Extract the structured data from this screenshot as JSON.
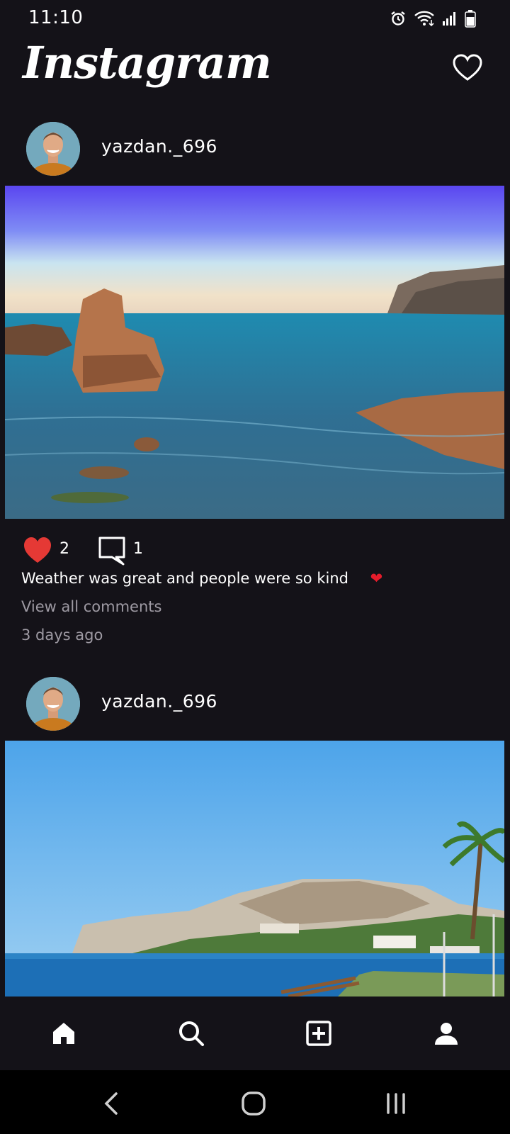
{
  "status_bar": {
    "time": "11:10",
    "icons": [
      "alarm-icon",
      "wifi-icon",
      "signal-icon",
      "battery-icon"
    ]
  },
  "header": {
    "logo": "Instagram",
    "activity_icon": "heart-outline-icon"
  },
  "posts": [
    {
      "username": "yazdan._696",
      "likes": "2",
      "comments": "1",
      "caption": "Weather was great and people were so kind",
      "caption_emoji": "❤",
      "view_comments": "View all comments",
      "time_ago": "3 days ago"
    },
    {
      "username": "yazdan._696"
    }
  ],
  "bottom_nav": {
    "items": [
      "home-icon",
      "search-icon",
      "add-post-icon",
      "profile-icon"
    ]
  },
  "system_nav": {
    "items": [
      "back-icon",
      "home-circle-icon",
      "recents-icon"
    ]
  },
  "colors": {
    "background": "#141218",
    "like_red": "#e53935",
    "muted_text": "#9e9aa3"
  }
}
